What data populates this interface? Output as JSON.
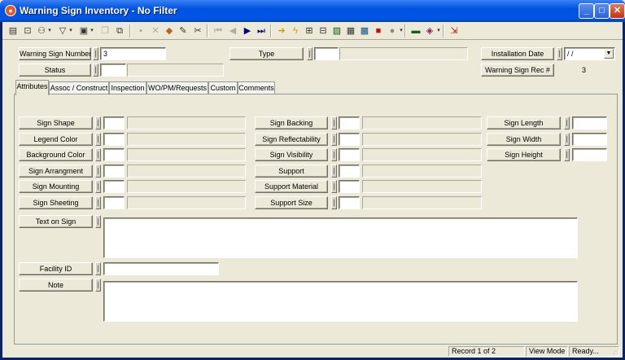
{
  "window": {
    "title": "Warning Sign Inventory - No Filter"
  },
  "title_buttons": {
    "minimize": "_",
    "maximize": "□",
    "close": "✕"
  },
  "toolbar": {
    "icons": [
      "form-icon",
      "search-form-icon",
      "binoculars-icon",
      "dropdown-arrow",
      "filter-icon",
      "dropdown-arrow",
      "new-record-icon",
      "dropdown-arrow",
      "copy-record-icon",
      "copy-form-icon",
      "save-icon",
      "delete-icon",
      "cancel-icon",
      "edit-icon",
      "cut-icon",
      "first-record-icon",
      "previous-record-icon",
      "next-record-icon",
      "last-record-icon",
      "goto-icon",
      "lightning-icon",
      "hierarchy-icon",
      "tree-icon",
      "image-icon",
      "calendar-icon",
      "map-icon",
      "sign-icon",
      "globe-icon",
      "dropdown-arrow",
      "report-icon",
      "book-icon",
      "dropdown-arrow",
      "exit-icon"
    ]
  },
  "header": {
    "warning_sign_number_label": "Warning Sign Number",
    "warning_sign_number_value": "3",
    "status_label": "Status",
    "status_value": "",
    "type_label": "Type",
    "type_value": "",
    "installation_date_label": "Installation Date",
    "installation_date_value": " / /",
    "warning_sign_rec_label": "Warning Sign Rec #",
    "warning_sign_rec_value": "3"
  },
  "tabs": [
    "Attributes",
    "Assoc / Construct",
    "Inspection",
    "WO/PM/Requests",
    "Custom",
    "Comments"
  ],
  "attributes": {
    "col1": [
      "Sign Shape",
      "Legend Color",
      "Background Color",
      "Sign Arrangment",
      "Sign Mounting",
      "Sign Sheeting"
    ],
    "col2": [
      "Sign Backing",
      "Sign Reflectability",
      "Sign Visibility",
      "Support",
      "Support Material",
      "Support Size"
    ],
    "col3": [
      "Sign Length",
      "Sign Width",
      "Sign Height"
    ],
    "text_on_sign_label": "Text on Sign",
    "facility_id_label": "Facility ID",
    "note_label": "Note"
  },
  "statusbar": {
    "record": "Record 1 of 2",
    "mode": "View Mode",
    "state": "Ready..."
  }
}
